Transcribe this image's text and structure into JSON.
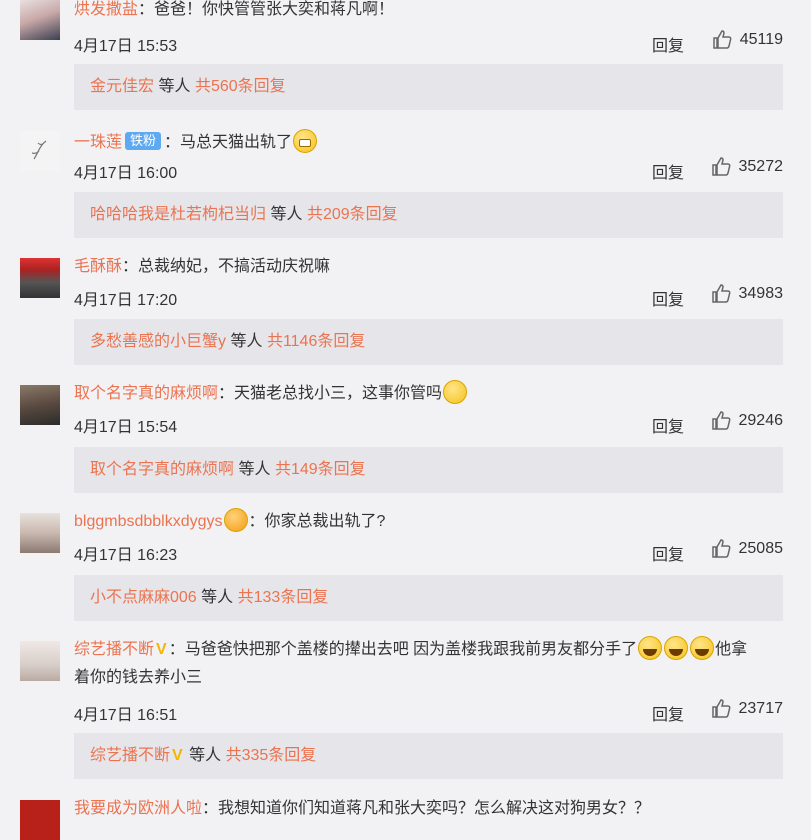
{
  "comments": [
    {
      "username": "烘发撒盐",
      "badge": "",
      "vip": false,
      "text_before_emoji": "：爸爸！你快管管张大奕和蒋凡啊！",
      "emojis": [],
      "text_after_emoji": "",
      "date": "4月17日 15:53",
      "reply_label": "回复",
      "likes": "45119",
      "replies": {
        "user": "金元佳宏",
        "middle": "等人",
        "count_text": "共560条回复",
        "vip": false
      }
    },
    {
      "username": "一珠莲",
      "badge": "铁粉",
      "vip": false,
      "text_before_emoji": "：马总天猫出轨了",
      "emojis": [
        "grin-emoji"
      ],
      "text_after_emoji": "",
      "date": "4月17日 16:00",
      "reply_label": "回复",
      "likes": "35272",
      "replies": {
        "user": "哈哈哈我是杜若枸杞当归",
        "middle": "等人",
        "count_text": "共209条回复",
        "vip": false
      }
    },
    {
      "username": "毛酥酥",
      "badge": "",
      "vip": false,
      "text_before_emoji": "：总裁纳妃，不搞活动庆祝嘛",
      "emojis": [],
      "text_after_emoji": "",
      "date": "4月17日 17:20",
      "reply_label": "回复",
      "likes": "34983",
      "replies": {
        "user": "多愁善感的小巨蟹y",
        "middle": "等人",
        "count_text": "共1146条回复",
        "vip": false
      }
    },
    {
      "username": "取个名字真的麻烦啊",
      "badge": "",
      "vip": false,
      "text_before_emoji": "：天猫老总找小三，这事你管吗",
      "emojis": [
        "shy-emoji"
      ],
      "text_after_emoji": "",
      "date": "4月17日 15:54",
      "reply_label": "回复",
      "likes": "29246",
      "replies": {
        "user": "取个名字真的麻烦啊",
        "middle": "等人",
        "count_text": "共149条回复",
        "vip": false
      }
    },
    {
      "username": "blggmbsdbblkxdygys",
      "badge": "",
      "vip": false,
      "text_before_emoji": "",
      "emojis": [
        "love-emoji"
      ],
      "text_after_emoji": "：你家总裁出轨了?",
      "date": "4月17日 16:23",
      "reply_label": "回复",
      "likes": "25085",
      "replies": {
        "user": "小不点麻麻006",
        "middle": "等人",
        "count_text": "共133条回复",
        "vip": false
      }
    },
    {
      "username": "综艺播不断",
      "badge": "",
      "vip": true,
      "text_before_emoji": "：马爸爸快把那个盖楼的撵出去吧 因为盖楼我跟我前男友都分手了",
      "emojis": [
        "cry-laugh-emoji",
        "cry-laugh-emoji",
        "cry-laugh-emoji"
      ],
      "text_after_emoji": "他拿",
      "text_line2": "着你的钱去养小三",
      "date": "4月17日 16:51",
      "reply_label": "回复",
      "likes": "23717",
      "replies": {
        "user": "综艺播不断",
        "middle": "等人",
        "count_text": "共335条回复",
        "vip": true
      }
    },
    {
      "username": "我要成为欧洲人啦",
      "badge": "",
      "vip": false,
      "text_before_emoji": "：我想知道你们知道蒋凡和张大奕吗？怎么解决这对狗男女？？",
      "emojis": [],
      "text_after_emoji": "",
      "date": "",
      "reply_label": "",
      "likes": "",
      "replies": null
    }
  ],
  "icons": {
    "like": "thumbs-up-icon",
    "vip": "v-badge-icon"
  },
  "colors": {
    "username": "#eb7350",
    "background": "#f2f2f5",
    "reply_box": "#e6e6ea",
    "badge": "#5fa9f1",
    "vip": "#f7b500"
  }
}
